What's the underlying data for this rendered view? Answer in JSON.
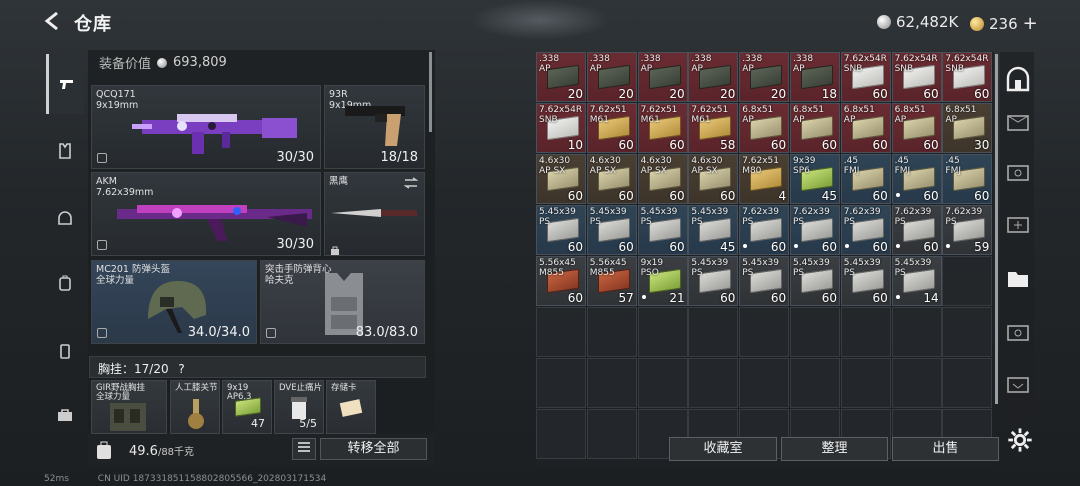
{
  "header": {
    "title": "仓库",
    "currency1": "62,482K",
    "currency2": "236",
    "plus": "+"
  },
  "loadout": {
    "equip_value_label": "装备价值",
    "equip_value": "693,809",
    "primary": {
      "name": "QCQ171",
      "caliber": "9x19mm",
      "ammo": "30/30"
    },
    "secondary": {
      "name": "93R",
      "caliber": "9x19mm",
      "ammo": "18/18"
    },
    "primary2": {
      "name": "AKM",
      "caliber": "7.62x39mm",
      "ammo": "30/30"
    },
    "melee": {
      "name": "黑鹰"
    },
    "helmet": {
      "name": "MC201 防弹头盔",
      "brand": "全球力量",
      "durability": "34.0/34.0"
    },
    "armor": {
      "name": "突击手防弹背心",
      "brand": "哈夫克",
      "durability": "83.0/83.0"
    },
    "chest_rig": {
      "label": "胸挂：17/20",
      "help": "?"
    },
    "rig_items": [
      {
        "name": "GIR野战胸挂",
        "sub": "全球力量",
        "qty": ""
      },
      {
        "name": "人工膝关节",
        "sub": "",
        "qty": ""
      },
      {
        "name": "9x19",
        "sub": "AP6.3",
        "qty": "47"
      },
      {
        "name": "DVE止痛片",
        "sub": "",
        "qty": "5/5"
      },
      {
        "name": "存储卡",
        "sub": "",
        "qty": ""
      }
    ],
    "weight": "49.6",
    "weight_max": "/88千克",
    "transfer_all": "转移全部"
  },
  "grid": {
    "items": [
      {
        "n": ".338",
        "s": "AP",
        "q": "20",
        "c": "red",
        "b": "gry",
        "d": false
      },
      {
        "n": ".338",
        "s": "AP",
        "q": "20",
        "c": "red",
        "b": "gry",
        "d": false
      },
      {
        "n": ".338",
        "s": "AP",
        "q": "20",
        "c": "red",
        "b": "gry",
        "d": false
      },
      {
        "n": ".338",
        "s": "AP",
        "q": "20",
        "c": "red",
        "b": "gry",
        "d": false
      },
      {
        "n": ".338",
        "s": "AP",
        "q": "20",
        "c": "red",
        "b": "gry",
        "d": false
      },
      {
        "n": ".338",
        "s": "AP",
        "q": "18",
        "c": "red",
        "b": "gry",
        "d": false
      },
      {
        "n": "7.62x54R",
        "s": "SNB",
        "q": "60",
        "c": "red",
        "b": "wht",
        "d": false
      },
      {
        "n": "7.62x54R",
        "s": "SNB",
        "q": "60",
        "c": "red",
        "b": "wht",
        "d": false
      },
      {
        "n": "7.62x54R",
        "s": "SNB",
        "q": "60",
        "c": "red",
        "b": "wht",
        "d": false
      },
      {
        "n": "7.62x54R",
        "s": "SNB",
        "q": "10",
        "c": "red",
        "b": "wht",
        "d": false
      },
      {
        "n": "7.62x51",
        "s": "M61",
        "q": "60",
        "c": "red",
        "b": "tan",
        "d": false
      },
      {
        "n": "7.62x51",
        "s": "M61",
        "q": "60",
        "c": "red",
        "b": "tan",
        "d": false
      },
      {
        "n": "7.62x51",
        "s": "M61",
        "q": "58",
        "c": "red",
        "b": "tan",
        "d": false
      },
      {
        "n": "6.8x51",
        "s": "AP",
        "q": "60",
        "c": "red",
        "b": "khk",
        "d": false
      },
      {
        "n": "6.8x51",
        "s": "AP",
        "q": "60",
        "c": "red",
        "b": "khk",
        "d": false
      },
      {
        "n": "6.8x51",
        "s": "AP",
        "q": "60",
        "c": "red",
        "b": "khk",
        "d": false
      },
      {
        "n": "6.8x51",
        "s": "AP",
        "q": "60",
        "c": "red",
        "b": "khk",
        "d": false
      },
      {
        "n": "6.8x51",
        "s": "AP",
        "q": "30",
        "c": "brown",
        "b": "khk",
        "d": false
      },
      {
        "n": "4.6x30",
        "s": "AP SX",
        "q": "60",
        "c": "brown",
        "b": "khk",
        "d": false
      },
      {
        "n": "4.6x30",
        "s": "AP SX",
        "q": "60",
        "c": "brown",
        "b": "khk",
        "d": false
      },
      {
        "n": "4.6x30",
        "s": "AP SX",
        "q": "60",
        "c": "brown",
        "b": "khk",
        "d": false
      },
      {
        "n": "4.6x30",
        "s": "AP SX",
        "q": "60",
        "c": "brown",
        "b": "khk",
        "d": false
      },
      {
        "n": "7.62x51",
        "s": "M80",
        "q": "4",
        "c": "brown",
        "b": "tan",
        "d": false
      },
      {
        "n": "9x39",
        "s": "SP6",
        "q": "45",
        "c": "blue",
        "b": "grn",
        "d": false
      },
      {
        "n": ".45",
        "s": "FMJ",
        "q": "60",
        "c": "blue",
        "b": "khk",
        "d": false
      },
      {
        "n": ".45",
        "s": "FMJ",
        "q": "60",
        "c": "blue",
        "b": "khk",
        "d": true
      },
      {
        "n": ".45",
        "s": "FMJ",
        "q": "60",
        "c": "blue",
        "b": "khk",
        "d": false
      },
      {
        "n": "5.45x39",
        "s": "PS",
        "q": "60",
        "c": "blue",
        "b": "lgy",
        "d": false
      },
      {
        "n": "5.45x39",
        "s": "PS",
        "q": "60",
        "c": "blue",
        "b": "lgy",
        "d": false
      },
      {
        "n": "5.45x39",
        "s": "PS",
        "q": "60",
        "c": "blue",
        "b": "lgy",
        "d": false
      },
      {
        "n": "5.45x39",
        "s": "PS",
        "q": "45",
        "c": "blue",
        "b": "lgy",
        "d": false
      },
      {
        "n": "7.62x39",
        "s": "PS",
        "q": "60",
        "c": "blue",
        "b": "lgy",
        "d": true
      },
      {
        "n": "7.62x39",
        "s": "PS",
        "q": "60",
        "c": "blue",
        "b": "lgy",
        "d": true
      },
      {
        "n": "7.62x39",
        "s": "PS",
        "q": "60",
        "c": "blue",
        "b": "lgy",
        "d": true
      },
      {
        "n": "7.62x39",
        "s": "PS",
        "q": "60",
        "c": "gray",
        "b": "lgy",
        "d": true
      },
      {
        "n": "7.62x39",
        "s": "PS",
        "q": "59",
        "c": "gray",
        "b": "lgy",
        "d": true
      },
      {
        "n": "5.56x45",
        "s": "M855",
        "q": "60",
        "c": "gray",
        "b": "rdb",
        "d": false
      },
      {
        "n": "5.56x45",
        "s": "M855",
        "q": "57",
        "c": "gray",
        "b": "rdb",
        "d": false
      },
      {
        "n": "9x19",
        "s": "PSO",
        "q": "21",
        "c": "gray",
        "b": "grn",
        "d": true
      },
      {
        "n": "5.45x39",
        "s": "PS",
        "q": "60",
        "c": "gray",
        "b": "lgy",
        "d": false
      },
      {
        "n": "5.45x39",
        "s": "PS",
        "q": "60",
        "c": "gray",
        "b": "lgy",
        "d": false
      },
      {
        "n": "5.45x39",
        "s": "PS",
        "q": "60",
        "c": "gray",
        "b": "lgy",
        "d": false
      },
      {
        "n": "5.45x39",
        "s": "PS",
        "q": "60",
        "c": "gray",
        "b": "lgy",
        "d": false
      },
      {
        "n": "5.45x39",
        "s": "PS",
        "q": "14",
        "c": "gray",
        "b": "lgy",
        "d": true
      }
    ],
    "buttons": {
      "collection": "收藏室",
      "sort": "整理",
      "sell": "出售"
    }
  },
  "footer": {
    "ping": "52ms",
    "uid": "CN UID 187331851158802805566_202803171534"
  }
}
